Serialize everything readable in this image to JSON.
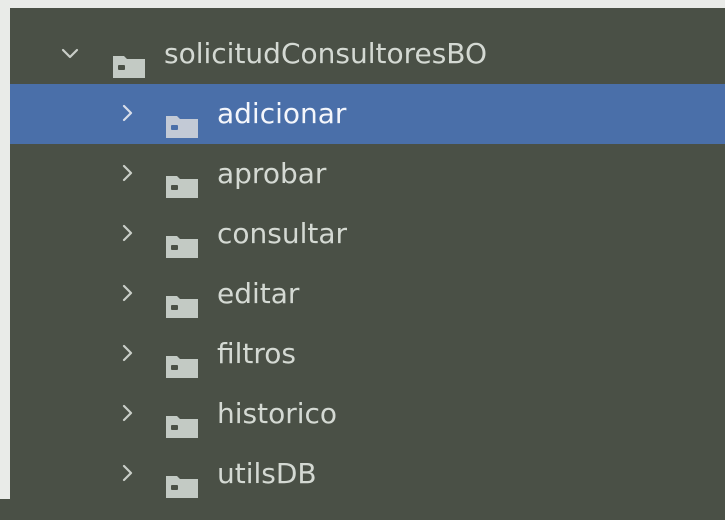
{
  "colors": {
    "background": "#4a5046",
    "text": "#d4d9d3",
    "selection": "#4a6fa9",
    "selectedText": "#f4f6fb",
    "folder": "#c3cac4",
    "border": "#e9ebe8"
  },
  "tree": {
    "root": {
      "label": "solicitudConsultoresBO",
      "expanded": true,
      "chevron_icon": "chevron-down",
      "folder_icon": "folder"
    },
    "children": [
      {
        "label": "adicionar",
        "selected": true,
        "chevron_icon": "chevron-right",
        "folder_icon": "folder"
      },
      {
        "label": "aprobar",
        "selected": false,
        "chevron_icon": "chevron-right",
        "folder_icon": "folder"
      },
      {
        "label": "consultar",
        "selected": false,
        "chevron_icon": "chevron-right",
        "folder_icon": "folder"
      },
      {
        "label": "editar",
        "selected": false,
        "chevron_icon": "chevron-right",
        "folder_icon": "folder"
      },
      {
        "label": "filtros",
        "selected": false,
        "chevron_icon": "chevron-right",
        "folder_icon": "folder"
      },
      {
        "label": "historico",
        "selected": false,
        "chevron_icon": "chevron-right",
        "folder_icon": "folder"
      },
      {
        "label": "utilsDB",
        "selected": false,
        "chevron_icon": "chevron-right",
        "folder_icon": "folder"
      }
    ]
  }
}
